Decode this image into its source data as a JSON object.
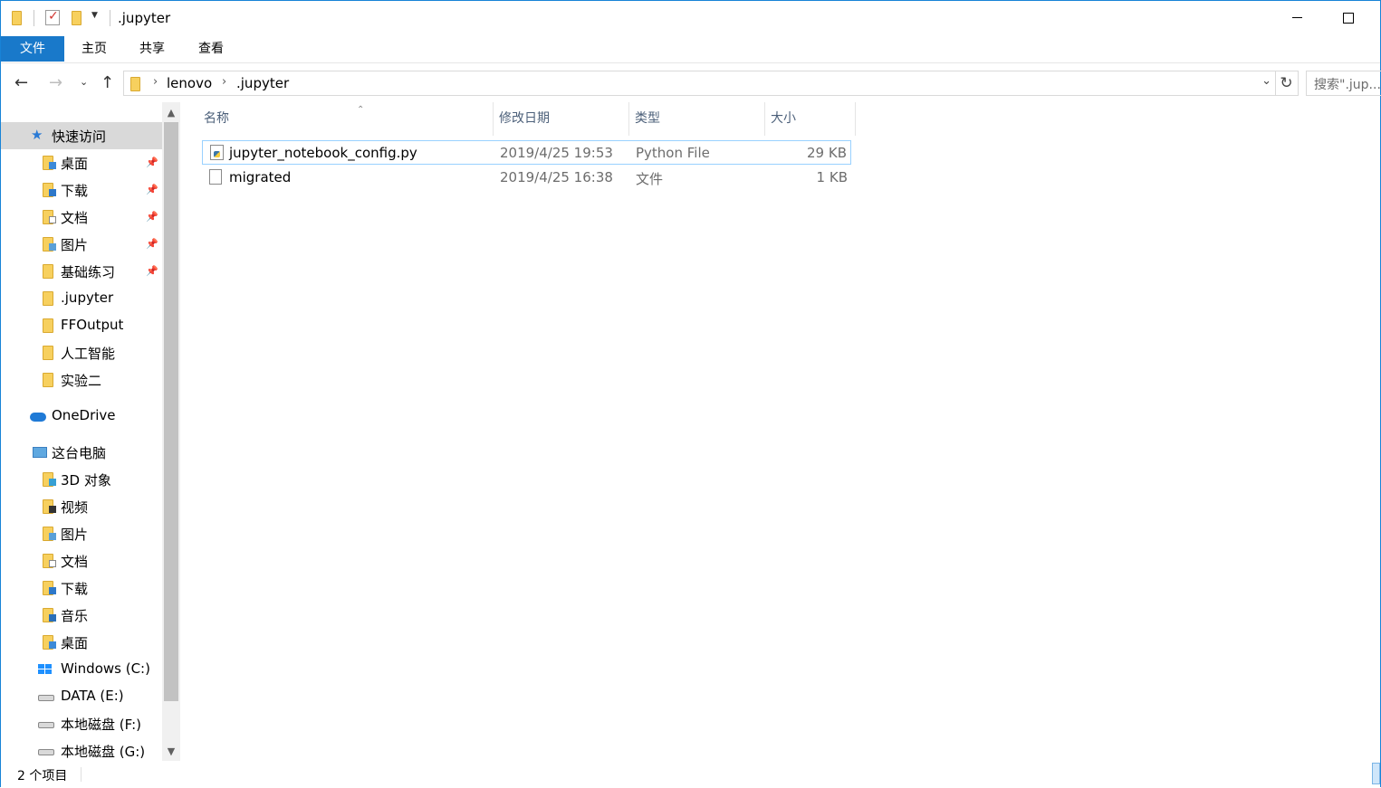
{
  "window": {
    "title": ".jupyter",
    "accent": "#1979ca"
  },
  "ribbon": {
    "tabs": [
      {
        "label": "文件",
        "active": true
      },
      {
        "label": "主页"
      },
      {
        "label": "共享"
      },
      {
        "label": "查看"
      }
    ]
  },
  "address": {
    "crumbs": [
      "lenovo",
      ".jupyter"
    ],
    "search_placeholder": "搜索\".jup..."
  },
  "nav": {
    "quick_access": "快速访问",
    "quick_items": [
      {
        "label": "桌面",
        "icon": "desktop-folder-icon",
        "pinned": true
      },
      {
        "label": "下载",
        "icon": "downloads-folder-icon",
        "pinned": true
      },
      {
        "label": "文档",
        "icon": "documents-folder-icon",
        "pinned": true
      },
      {
        "label": "图片",
        "icon": "pictures-folder-icon",
        "pinned": true
      },
      {
        "label": "基础练习",
        "icon": "folder-icon",
        "pinned": true
      },
      {
        "label": ".jupyter",
        "icon": "folder-icon"
      },
      {
        "label": "FFOutput",
        "icon": "folder-icon"
      },
      {
        "label": "人工智能",
        "icon": "folder-icon"
      },
      {
        "label": "实验二",
        "icon": "folder-icon"
      }
    ],
    "onedrive": "OneDrive",
    "this_pc": "这台电脑",
    "pc_items": [
      {
        "label": "3D 对象",
        "icon": "3d-objects-folder-icon"
      },
      {
        "label": "视频",
        "icon": "videos-folder-icon"
      },
      {
        "label": "图片",
        "icon": "pictures-folder-icon"
      },
      {
        "label": "文档",
        "icon": "documents-folder-icon"
      },
      {
        "label": "下载",
        "icon": "downloads-folder-icon"
      },
      {
        "label": "音乐",
        "icon": "music-folder-icon"
      },
      {
        "label": "桌面",
        "icon": "desktop-folder-icon"
      },
      {
        "label": "Windows (C:)",
        "icon": "windows-drive-icon"
      },
      {
        "label": "DATA (E:)",
        "icon": "drive-icon"
      },
      {
        "label": "本地磁盘 (F:)",
        "icon": "drive-icon"
      },
      {
        "label": "本地磁盘 (G:)",
        "icon": "drive-icon"
      }
    ]
  },
  "columns": {
    "name": "名称",
    "modified": "修改日期",
    "type": "类型",
    "size": "大小"
  },
  "files": [
    {
      "name": "jupyter_notebook_config.py",
      "modified": "2019/4/25 19:53",
      "type": "Python File",
      "size": "29 KB",
      "icon": "python-file-icon",
      "selected": true
    },
    {
      "name": "migrated",
      "modified": "2019/4/25 16:38",
      "type": "文件",
      "size": "1 KB",
      "icon": "file-icon"
    }
  ],
  "status": {
    "count": "2 个项目"
  }
}
